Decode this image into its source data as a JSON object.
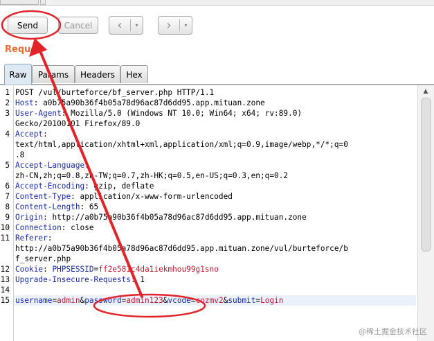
{
  "toolbar": {
    "send_label": "Send",
    "cancel_label": "Cancel",
    "back_icon": "‹",
    "forward_icon": "›",
    "dropdown_icon": "▾"
  },
  "section_title": "Reques",
  "tabs": [
    {
      "label": "Raw",
      "active": true
    },
    {
      "label": "Params",
      "active": false
    },
    {
      "label": "Headers",
      "active": false
    },
    {
      "label": "Hex",
      "active": false
    }
  ],
  "request": {
    "request_line": "POST /vul/burteforce/bf_server.php HTTP/1.1",
    "headers": [
      {
        "num": "2",
        "name": "Host",
        "value": " a0b75a90b36f4b05a78d96ac87d6dd95.app.mituan.zone"
      },
      {
        "num": "3",
        "name": "User-Agent",
        "value": " Mozilla/5.0 (Windows NT 10.0; Win64; x64; rv:89.0)",
        "cont": "Gecko/20100101 Firefox/89.0"
      },
      {
        "num": "4",
        "name": "Accept",
        "value": "",
        "cont": "text/html,application/xhtml+xml,application/xml;q=0.9,image/webp,*/*;q=0",
        "cont2": ".8"
      },
      {
        "num": "5",
        "name": "Accept-Language",
        "value": "",
        "cont": "zh-CN,zh;q=0.8,zh-TW;q=0.7,zh-HK;q=0.5,en-US;q=0.3,en;q=0.2"
      },
      {
        "num": "6",
        "name": "Accept-Encoding",
        "value": " gzip, deflate"
      },
      {
        "num": "7",
        "name": "Content-Type",
        "value": " application/x-www-form-urlencoded"
      },
      {
        "num": "8",
        "name": "Content-Length",
        "value": " 65"
      },
      {
        "num": "9",
        "name": "Origin",
        "value": " http://a0b75a90b36f4b05a78d96ac87d6dd95.app.mituan.zone"
      },
      {
        "num": "10",
        "name": "Connection",
        "value": " close"
      },
      {
        "num": "11",
        "name": "Referer",
        "value": "",
        "cont": "http://a0b75a90b36f4b05a78d96ac87d6dd95.app.mituan.zone/vul/burteforce/b",
        "cont2": "f_server.php"
      },
      {
        "num": "12",
        "name": "Cookie",
        "value": " ",
        "cookie_name": "PHPSESSID",
        "cookie_eq": "=",
        "cookie_value": "ff2e581c4da1iekmhou99g1sno"
      },
      {
        "num": "13",
        "name": "Upgrade-Insecure-Requests",
        "value": " 1"
      }
    ],
    "blank_line_num": "14",
    "body_line_num": "15",
    "body_params": [
      {
        "name": "username",
        "value": "admin"
      },
      {
        "name": "password",
        "value": "admin123"
      },
      {
        "name": "vcode",
        "value": "cozmv2"
      },
      {
        "name": "submit",
        "value": "Login"
      }
    ]
  },
  "annotation_color": "#e2232a",
  "watermark": "@稀土掘金技术社区"
}
